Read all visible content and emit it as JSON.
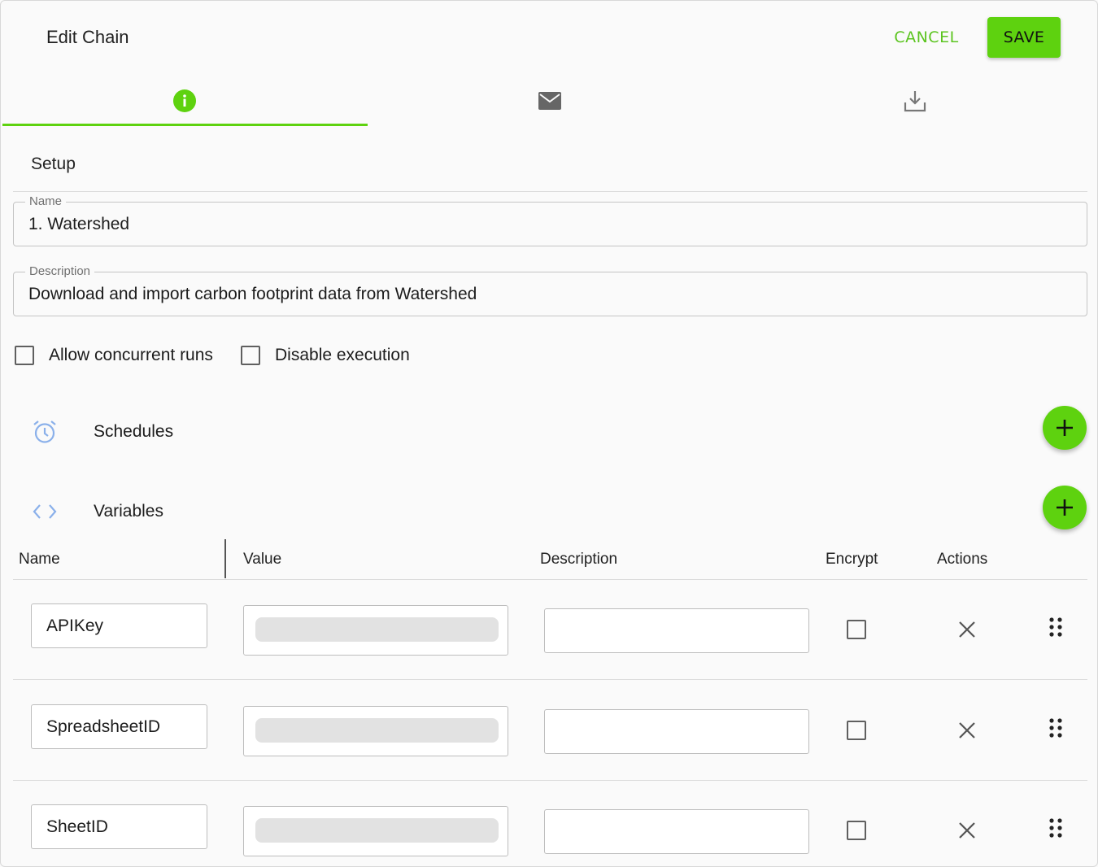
{
  "header": {
    "title": "Edit Chain",
    "cancel_label": "CANCEL",
    "save_label": "SAVE"
  },
  "tabs": [
    {
      "icon": "info-icon",
      "active": true
    },
    {
      "icon": "mail-icon",
      "active": false
    },
    {
      "icon": "download-icon",
      "active": false
    }
  ],
  "setup": {
    "section_title": "Setup",
    "name_label": "Name",
    "name_value": "1. Watershed",
    "description_label": "Description",
    "description_value": "Download and import carbon footprint data from Watershed",
    "allow_concurrent_label": "Allow concurrent runs",
    "allow_concurrent_checked": false,
    "disable_execution_label": "Disable execution",
    "disable_execution_checked": false
  },
  "schedules": {
    "label": "Schedules",
    "icon": "alarm-clock-icon"
  },
  "variables": {
    "label": "Variables",
    "icon": "code-brackets-icon",
    "columns": [
      "Name",
      "Value",
      "Description",
      "Encrypt",
      "Actions"
    ],
    "rows": [
      {
        "name": "APIKey",
        "value": "",
        "description": "",
        "encrypt": false
      },
      {
        "name": "SpreadsheetID",
        "value": "",
        "description": "",
        "encrypt": false
      },
      {
        "name": "SheetID",
        "value": "",
        "description": "",
        "encrypt": false
      }
    ]
  },
  "colors": {
    "accent": "#5ed20f",
    "accent_text": "#5bc41f",
    "icon_blue": "#8ab0ea"
  }
}
